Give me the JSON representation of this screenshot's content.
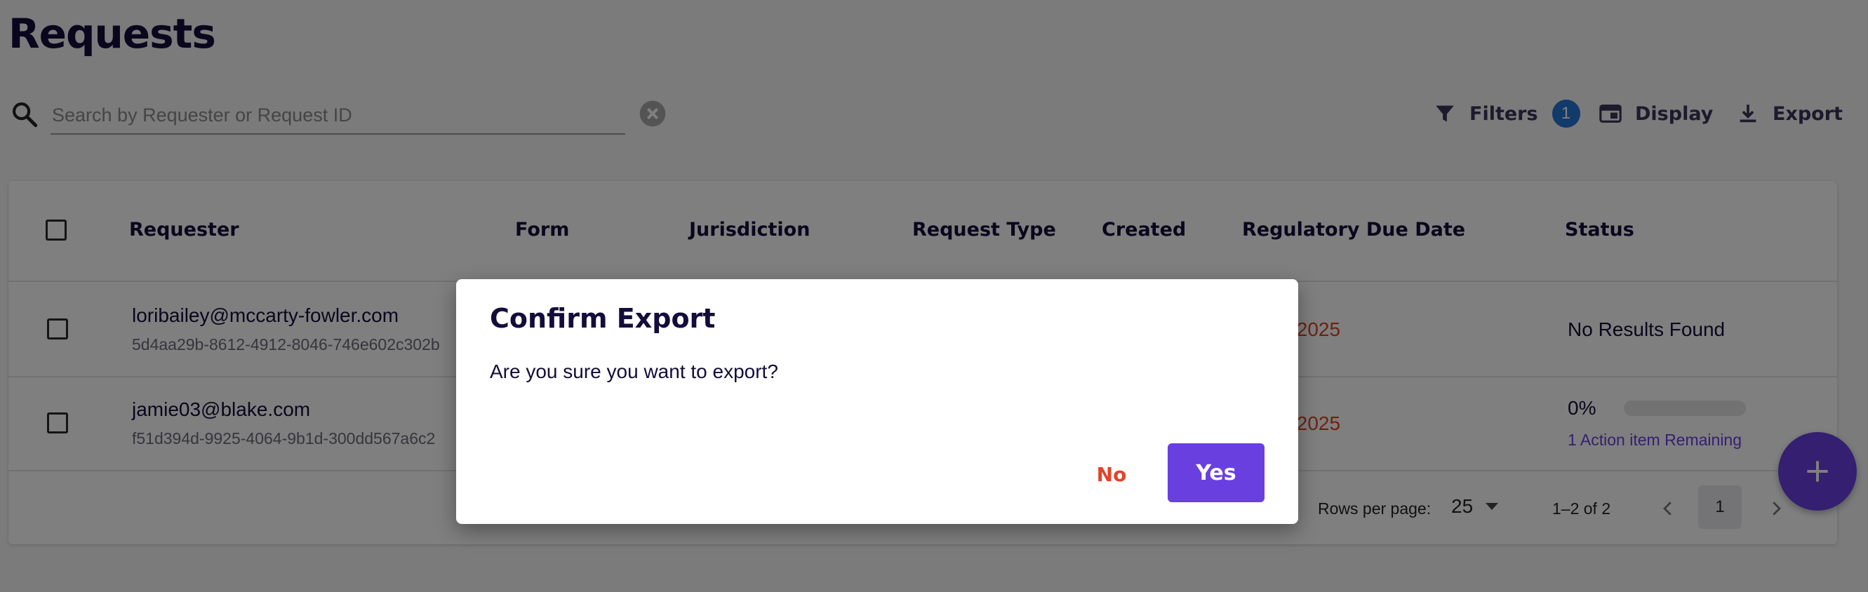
{
  "page": {
    "title": "Requests"
  },
  "search": {
    "placeholder": "Search by Requester or Request ID"
  },
  "toolbar": {
    "filters_label": "Filters",
    "filters_count": "1",
    "display_label": "Display",
    "export_label": "Export"
  },
  "table": {
    "columns": [
      "Requester",
      "Form",
      "Jurisdiction",
      "Request Type",
      "Created",
      "Regulatory Due Date",
      "Status"
    ],
    "rows": [
      {
        "email": "loribailey@mccarty-fowler.com",
        "id": "5d4aa29b-8612-4912-8046-746e602c302b",
        "due_visible": "/2025",
        "status": "No Results Found"
      },
      {
        "email": "jamie03@blake.com",
        "id": "f51d394d-9925-4064-9b1d-300dd567a6c2",
        "due_visible": "/2025",
        "progress_label": "0%",
        "progress": 0.0,
        "action_link": "1 Action item Remaining"
      }
    ],
    "footer": {
      "rows_per_page_label": "Rows per page:",
      "rows_per_page_value": "25",
      "range": "1–2 of 2",
      "page": "1"
    }
  },
  "dialog": {
    "title": "Confirm Export",
    "message": "Are you sure you want to export?",
    "no_label": "No",
    "yes_label": "Yes"
  },
  "colors": {
    "accent": "#6a3fe0",
    "danger": "#e0442a",
    "badge": "#2474d4",
    "text": "#140c3a"
  },
  "icons": {
    "search": "search-icon",
    "clear": "clear-icon",
    "filter": "filter-icon",
    "display": "display-icon",
    "export": "download-icon",
    "fab": "plus-icon"
  }
}
